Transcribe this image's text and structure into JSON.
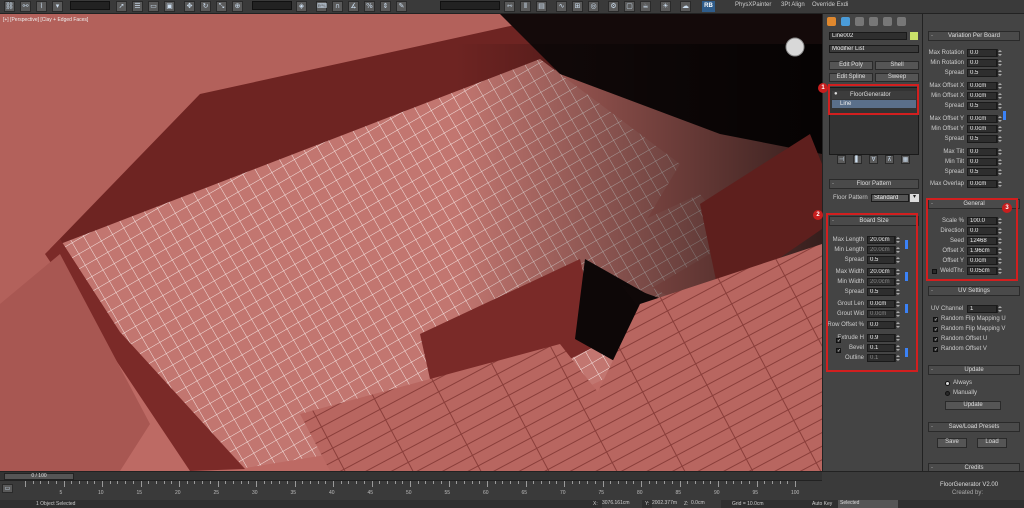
{
  "toolbar": {
    "menu_items": [
      "PhysXPainter",
      "3Pt Align",
      "Override Exdi"
    ],
    "rb_label": "RB"
  },
  "viewport": {
    "label": "[+] [Perspective] [Clay + Edged Faces]"
  },
  "modify_panel": {
    "object_name": "Line002",
    "object_color": "#c9e26a",
    "modifier_list_label": "Modifier List",
    "quick_buttons": [
      "Edit Poly",
      "Shell",
      "Edit Spline",
      "Sweep"
    ],
    "stack": [
      "FloorGenerator",
      "Line"
    ]
  },
  "floor_pattern": {
    "title": "Floor Pattern",
    "label": "Floor Pattern",
    "value": "Standard"
  },
  "board_size": {
    "title": "Board Size",
    "rows": [
      {
        "label": "Max Length",
        "value": "20.0cm"
      },
      {
        "label": "Min Length",
        "value": "20.0cm"
      },
      {
        "label": "Spread",
        "value": "0.5"
      },
      {
        "label": "Max Width",
        "value": "20.0cm"
      },
      {
        "label": "Min Width",
        "value": "20.0cm"
      },
      {
        "label": "Spread",
        "value": "0.5"
      },
      {
        "label": "Grout Len",
        "value": "0.0cm"
      },
      {
        "label": "Grout Wid",
        "value": "0.0cm"
      },
      {
        "label": "Row Offset %",
        "value": "0.0"
      },
      {
        "label": "Extrude H",
        "value": "0.9"
      },
      {
        "label": "Bevel",
        "value": "0.1"
      },
      {
        "label": "Outline",
        "value": "0.1"
      }
    ]
  },
  "variation": {
    "title": "Variation Per Board",
    "rows": [
      {
        "label": "Max Rotation",
        "value": "0.0"
      },
      {
        "label": "Min Rotation",
        "value": "0.0"
      },
      {
        "label": "Spread",
        "value": "0.5"
      },
      {
        "label": "Max Offset X",
        "value": "0.0cm"
      },
      {
        "label": "Min Offset X",
        "value": "0.0cm"
      },
      {
        "label": "Spread",
        "value": "0.5"
      },
      {
        "label": "Max Offset Y",
        "value": "0.0cm"
      },
      {
        "label": "Min Offset Y",
        "value": "0.0cm"
      },
      {
        "label": "Spread",
        "value": "0.5"
      },
      {
        "label": "Max Tilt",
        "value": "0.0"
      },
      {
        "label": "Min Tilt",
        "value": "0.0"
      },
      {
        "label": "Spread",
        "value": "0.5"
      },
      {
        "label": "Max Overlap",
        "value": "0.0cm"
      }
    ]
  },
  "general": {
    "title": "General",
    "rows": [
      {
        "label": "Scale %",
        "value": "100.0"
      },
      {
        "label": "Direction",
        "value": "0.0"
      },
      {
        "label": "Seed",
        "value": "12468"
      },
      {
        "label": "Offset X",
        "value": "1.96cm"
      },
      {
        "label": "Offset Y",
        "value": "0.0cm"
      },
      {
        "label": "WeldThr.",
        "value": "0.05cm"
      }
    ]
  },
  "uv_settings": {
    "title": "UV Settings",
    "channel_label": "UV Channel",
    "channel_value": "1",
    "checks": [
      "Random Flip Mapping U",
      "Random Flip Mapping V",
      "Random Offset U",
      "Random Offset V"
    ]
  },
  "update": {
    "title": "Update",
    "options": [
      "Always",
      "Manually"
    ],
    "button": "Update"
  },
  "presets": {
    "title": "Save/Load Presets",
    "save": "Save",
    "load": "Load"
  },
  "credits": {
    "title": "Credits",
    "line1": "FloorGenerator V2.00",
    "line2": "Created by:"
  },
  "annotations": {
    "badge1": "1",
    "badge2": "2",
    "badge3": "3"
  },
  "timeline": {
    "frame": "0 / 100",
    "ticks": [
      "5",
      "10",
      "15",
      "20",
      "25",
      "30",
      "35",
      "40",
      "45",
      "50",
      "55",
      "60",
      "65",
      "70",
      "75",
      "80",
      "85",
      "90",
      "95",
      "100"
    ]
  },
  "status": {
    "selection": "1 Object Selected",
    "x_label": "X:",
    "x_value": "3076.161cm",
    "y_label": "Y:",
    "y_value": "2002.377m",
    "z_label": "Z:",
    "z_value": "0.0cm",
    "grid": "Grid = 10.0cm",
    "autokey": "Auto Key",
    "selected": "Selected"
  },
  "colors": {
    "accent_red": "#d21f1f",
    "clay": "#bd6a64",
    "panel": "#444444"
  }
}
